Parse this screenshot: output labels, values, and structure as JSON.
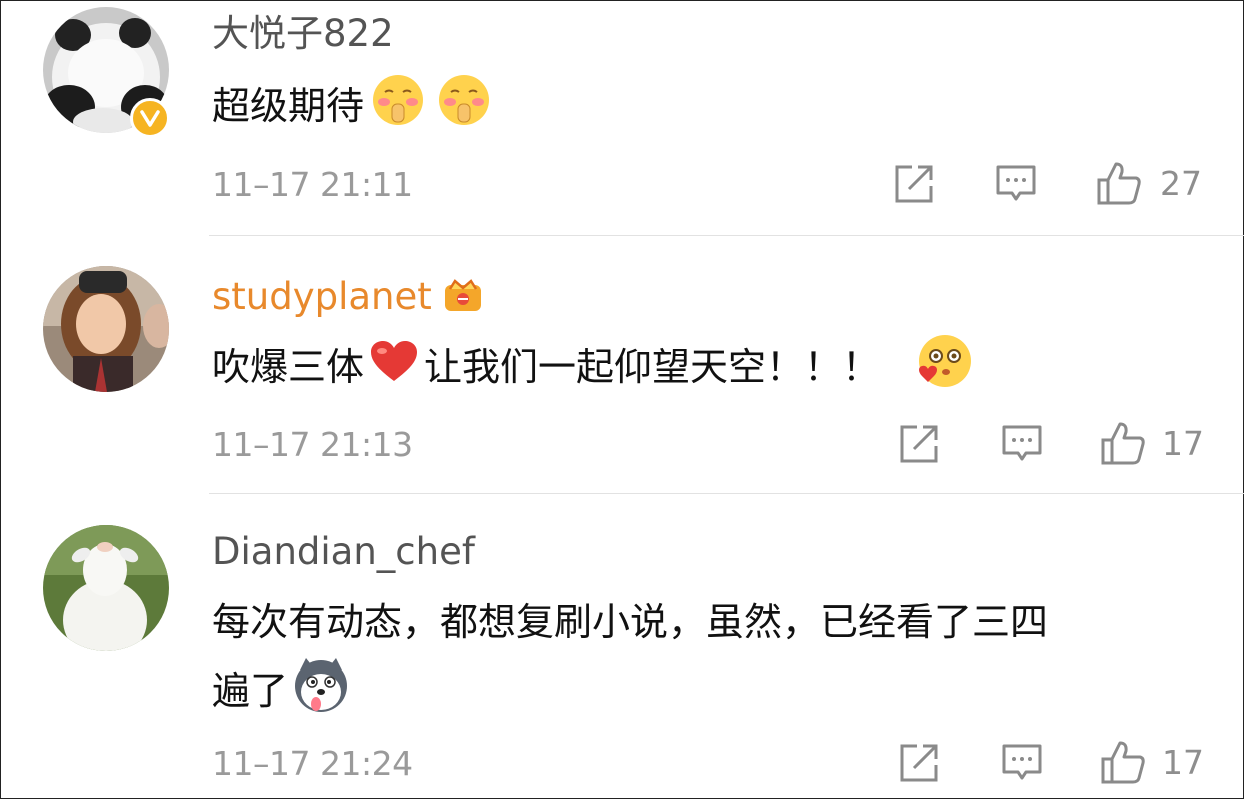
{
  "comments": [
    {
      "username": "大悦子822",
      "text_before": "超级期待",
      "text_after": "",
      "time": "11–17 21:11",
      "likes": "27",
      "verified_badge": "V",
      "name_color": "#545454"
    },
    {
      "username": "studyplanet",
      "text_before": "吹爆三体",
      "text_after": "让我们一起仰望天空！！！",
      "time": "11–17 21:13",
      "likes": "17",
      "name_color": "#e8892c"
    },
    {
      "username": "Diandian_chef",
      "text_line1": "每次有动态，都想复刷小说，虽然，已经看了三四",
      "text_line2": "遍了",
      "time": "11–17 21:24",
      "likes": "17",
      "name_color": "#545454"
    }
  ],
  "icons": {
    "repost": "repost-icon",
    "comment": "comment-icon",
    "like": "like-icon"
  }
}
